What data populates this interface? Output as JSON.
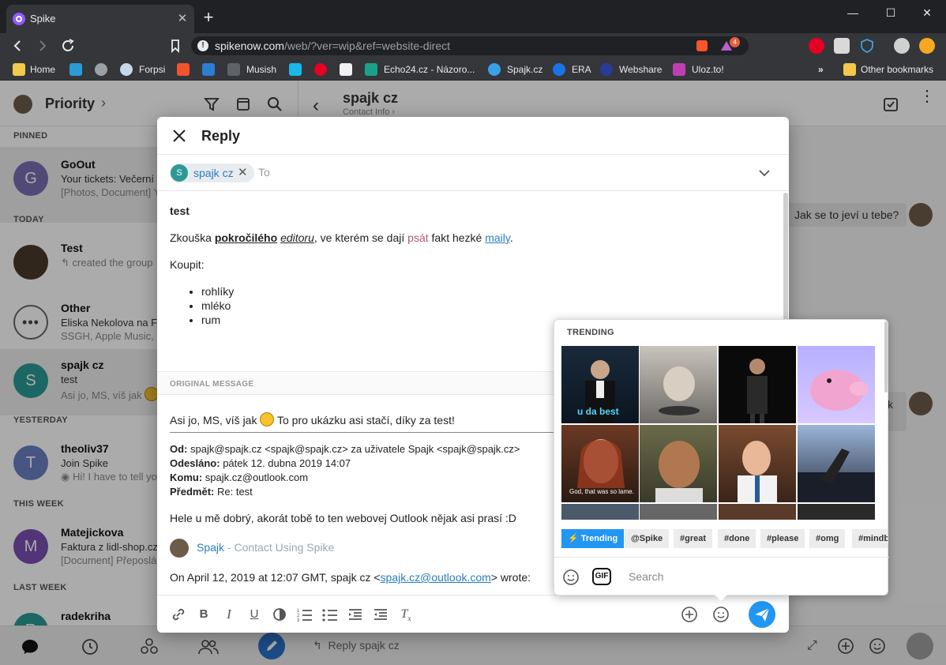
{
  "browser": {
    "tab_title": "Spike",
    "url_host": "spikenow.com",
    "url_path": "/web/?ver=wip&ref=website-direct",
    "badge_count": "4"
  },
  "bookmarks": [
    {
      "label": "Home"
    },
    {
      "label": "Forpsi"
    },
    {
      "label": "Musish"
    },
    {
      "label": "Echo24.cz - Názoro..."
    },
    {
      "label": "Spajk.cz"
    },
    {
      "label": "ERA"
    },
    {
      "label": "Webshare"
    },
    {
      "label": "Uloz.to!"
    },
    {
      "label": "Other bookmarks"
    }
  ],
  "sidebar": {
    "title": "Priority",
    "sections": {
      "pinned": "PINNED",
      "today": "TODAY",
      "yesterday": "YESTERDAY",
      "this_week": "THIS WEEK",
      "last_week": "LAST WEEK"
    },
    "conversations": [
      {
        "initial": "G",
        "name": "GoOut",
        "line1": "Your tickets: Večerní",
        "line2": "[Photos, Document] Y"
      },
      {
        "initial": "",
        "name": "Test",
        "line1": "",
        "line2": "created the group"
      },
      {
        "initial": "",
        "name": "Other",
        "line1": "Eliska Nekolova na F",
        "line2": "SSGH, Apple Music,"
      },
      {
        "initial": "S",
        "name": "spajk cz",
        "line1": "test",
        "line2": "Asi jo, MS, víš jak"
      },
      {
        "initial": "T",
        "name": "theoliv37",
        "line1": "Join Spike",
        "line2": "Hi! I have to tell yo"
      },
      {
        "initial": "M",
        "name": "Matejickova",
        "line1": "Faktura z lidl-shop.cz",
        "line2": "[Document] Přeposlá"
      },
      {
        "initial": "R",
        "name": "radekriha",
        "line1": "",
        "line2": ""
      }
    ]
  },
  "main": {
    "contact_name": "spajk cz",
    "contact_sub": "Contact Info",
    "bubble_right": "Jak se to jeví u tebe?",
    "bubble_partial": "k",
    "reply_placeholder": "Reply spajk cz"
  },
  "modal": {
    "title": "Reply",
    "recipient_initial": "S",
    "recipient": "spajk cz",
    "to_placeholder": "To",
    "body": {
      "heading": "test",
      "p1_a": "Zkouška ",
      "p1_bold": "pokročilého",
      "p1_space": " ",
      "p1_italic": "editoru",
      "p1_b": ", ve kterém se dají ",
      "p1_colored": "psát",
      "p1_c": " fakt hezké ",
      "p1_link": "maily",
      "p1_end": ".",
      "p2": "Koupit:",
      "list": [
        "rohlíky",
        "mléko",
        "rum"
      ]
    },
    "original_label": "ORIGINAL MESSAGE",
    "quote": {
      "line1_a": "Asi jo, MS, víš jak",
      "line1_b": "To pro ukázku asi stačí, díky za test!",
      "od_label": "Od:",
      "od": "spajk@spajk.cz <spajk@spajk.cz> za uživatele Spajk <spajk@spajk.cz>",
      "odeslano_label": "Odesláno:",
      "odeslano": "pátek 12. dubna 2019 14:07",
      "komu_label": "Komu:",
      "komu": "spajk.cz@outlook.com",
      "predmet_label": "Předmět:",
      "predmet": "Re: test",
      "line2": "Hele u mě dobrý, akorát tobě to ten webovej Outlook nějak asi prasí :D",
      "signature_name": "Spajk",
      "signature_rest": " - Contact Using Spike",
      "on_date": "On April 12, 2019 at 12:07 GMT, spajk cz <",
      "on_email": "spajk.cz@outlook.com",
      "on_end": "> wrote:"
    }
  },
  "gif_picker": {
    "heading": "TRENDING",
    "captions": [
      "u da best",
      "God, that was so lame."
    ],
    "tags": [
      "Trending",
      "@Spike",
      "#great",
      "#done",
      "#please",
      "#omg",
      "#mindb"
    ],
    "gif_label": "GIF",
    "search_placeholder": "Search"
  },
  "colors": {
    "accent": "#2196f3",
    "link": "#2a7dbf",
    "pink_text": "#b0587c"
  }
}
